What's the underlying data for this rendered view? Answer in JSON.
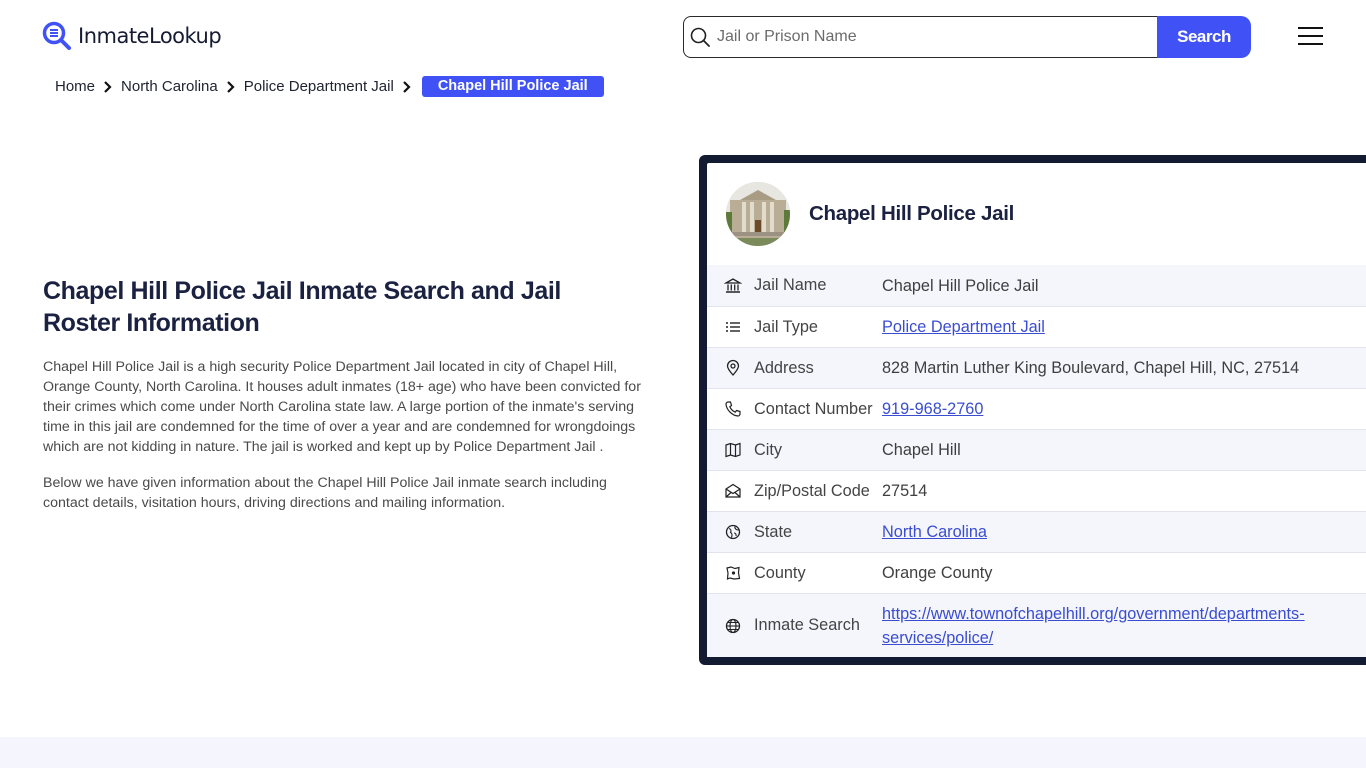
{
  "header": {
    "logo_text": "InmateLookup",
    "search_placeholder": "Jail or Prison Name",
    "search_value": "",
    "search_button_label": "Search",
    "menu_icon": "hamburger-menu-icon"
  },
  "breadcrumb": {
    "items": [
      "Home",
      "North Carolina",
      "Police Department Jail"
    ],
    "active": "Chapel Hill Police Jail"
  },
  "intro": {
    "title": "Chapel Hill Police Jail Inmate Search and Jail Roster Information",
    "paragraph1": "Chapel Hill Police Jail is a high security Police Department Jail located in city of Chapel Hill, Orange County, North Carolina. It houses adult inmates (18+ age) who have been convicted for their crimes which come under North Carolina state law. A large portion of the inmate's serving time in this jail are condemned for the time of over a year and are condemned for wrongdoings which are not kidding in nature. The jail is worked and kept up by Police Department Jail .",
    "paragraph2": "Below we have given information about the Chapel Hill Police Jail inmate search including contact details, visitation hours, driving directions and mailing information."
  },
  "card": {
    "title": "Chapel Hill Police Jail",
    "rows": [
      {
        "icon": "building-columns-icon",
        "label": "Jail Name",
        "value": "Chapel Hill Police Jail",
        "link": false
      },
      {
        "icon": "list-icon",
        "label": "Jail Type",
        "value": "Police Department Jail",
        "link": true
      },
      {
        "icon": "map-pin-icon",
        "label": "Address",
        "value": "828 Martin Luther King Boulevard, Chapel Hill, NC, 27514",
        "link": false
      },
      {
        "icon": "phone-icon",
        "label": "Contact Number",
        "value": "919-968-2760",
        "link": true
      },
      {
        "icon": "map-icon",
        "label": "City",
        "value": "Chapel Hill",
        "link": false
      },
      {
        "icon": "mail-open-icon",
        "label": "Zip/Postal Code",
        "value": "27514",
        "link": false
      },
      {
        "icon": "globe-stand-icon",
        "label": "State",
        "value": "North Carolina",
        "link": true
      },
      {
        "icon": "county-map-icon",
        "label": "County",
        "value": "Orange County",
        "link": false
      },
      {
        "icon": "world-icon",
        "label": "Inmate Search",
        "value": "https://www.townofchapelhill.org/government/departments-services/police/",
        "link": true
      }
    ]
  },
  "colors": {
    "accent": "#4052f6",
    "dark": "#131b33",
    "link": "#3a4dd0",
    "row_alt": "#f5f6fc"
  }
}
